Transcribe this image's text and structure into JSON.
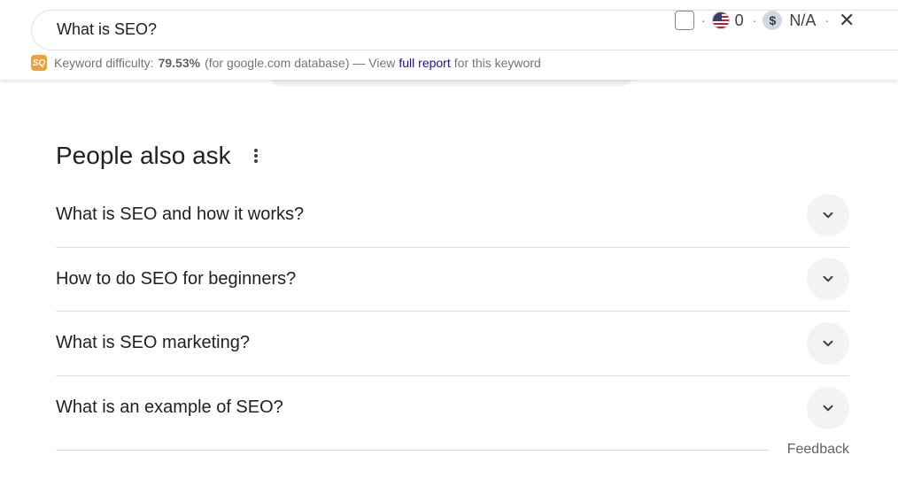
{
  "search": {
    "query": "What is SEO?",
    "volume_value": "0",
    "cpc_value": "N/A",
    "dot": "·",
    "dollar_symbol": "$",
    "close_symbol": "✕"
  },
  "keyword_difficulty": {
    "logo_text": "SQ",
    "label": "Keyword difficulty:",
    "value": "79.53%",
    "database_text": "(for google.com database) — View",
    "link_text": "full report",
    "suffix_text": "for this keyword"
  },
  "people_also_ask": {
    "title": "People also ask",
    "questions": [
      "What is SEO and how it works?",
      "How to do SEO for beginners?",
      "What is SEO marketing?",
      "What is an example of SEO?"
    ],
    "feedback_label": "Feedback"
  },
  "icons": {
    "more": "more-vert-icon",
    "chevron": "chevron-down-icon",
    "flag": "us-flag-icon",
    "dollar": "dollar-icon",
    "close": "close-icon"
  },
  "colors": {
    "link": "#1a0dab",
    "text": "#202124",
    "muted": "#70757a",
    "chevron_bg": "#f1f3f4",
    "divider": "#dadce0"
  }
}
